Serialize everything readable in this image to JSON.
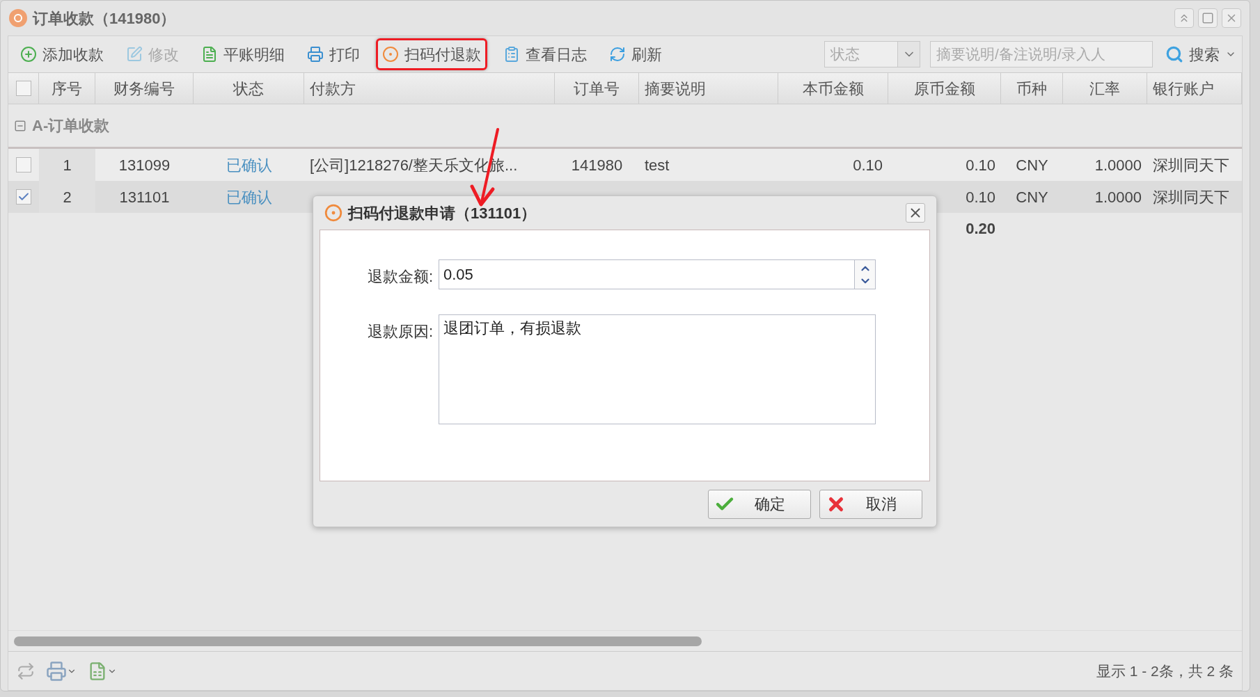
{
  "window": {
    "title": "订单收款（141980）"
  },
  "toolbar": {
    "buttons": [
      {
        "label": "添加收款",
        "disabled": false,
        "highlighted": false
      },
      {
        "label": "修改",
        "disabled": true,
        "highlighted": false
      },
      {
        "label": "平账明细",
        "disabled": false,
        "highlighted": false
      },
      {
        "label": "打印",
        "disabled": false,
        "highlighted": false
      },
      {
        "label": "扫码付退款",
        "disabled": false,
        "highlighted": true
      },
      {
        "label": "查看日志",
        "disabled": false,
        "highlighted": false
      },
      {
        "label": "刷新",
        "disabled": false,
        "highlighted": false
      }
    ],
    "status_select": {
      "placeholder": "状态"
    },
    "search_field": {
      "placeholder": "摘要说明/备注说明/录入人"
    },
    "search_button": "搜索"
  },
  "table": {
    "all_checked": false,
    "columns": [
      "序号",
      "财务编号",
      "状态",
      "付款方",
      "订单号",
      "摘要说明",
      "本币金额",
      "原币金额",
      "币种",
      "汇率",
      "银行账户"
    ],
    "group": {
      "label": "A-订单收款",
      "expanded": true
    },
    "rows": [
      {
        "checked": false,
        "cells": [
          "1",
          "131099",
          "已确认",
          "[公司]1218276/整天乐文化旅...",
          "141980",
          "test",
          "0.10",
          "0.10",
          "CNY",
          "1.0000",
          "深圳同天下"
        ]
      },
      {
        "checked": true,
        "cells": [
          "2",
          "131101",
          "已确认",
          null,
          null,
          null,
          null,
          "0.10",
          "CNY",
          "1.0000",
          "深圳同天下"
        ]
      }
    ],
    "totals": {
      "original_amount": "0.20"
    }
  },
  "dialog": {
    "title": "扫码付退款申请（131101）",
    "fields": [
      {
        "kind": "spinner",
        "label": "退款金额:",
        "value": "0.05"
      },
      {
        "kind": "textarea",
        "label": "退款原因:",
        "value": "退团订单，有损退款"
      }
    ],
    "buttons": [
      {
        "kind": "confirm",
        "label": "确定"
      },
      {
        "kind": "cancel",
        "label": "取消"
      }
    ]
  },
  "pager": {
    "summary": "显示 1 - 2条，共 2 条"
  }
}
